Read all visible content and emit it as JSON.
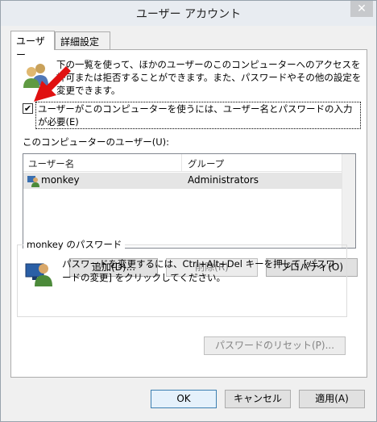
{
  "window": {
    "title": "ユーザー アカウント",
    "close_glyph": "✕"
  },
  "tabs": [
    {
      "label": "ユーザー",
      "active": true
    },
    {
      "label": "詳細設定",
      "active": false
    }
  ],
  "intro_text": "下の一覧を使って、ほかのユーザーのこのコンピューターへのアクセスを許可または拒否することができます。また、パスワードやその他の設定を変更できます。",
  "require_password": {
    "checked": true,
    "check_glyph": "✔",
    "label": "ユーザーがこのコンピューターを使うには、ユーザー名とパスワードの入力が必要(E)"
  },
  "users_section": {
    "label": "このコンピューターのユーザー(U):",
    "columns": [
      "ユーザー名",
      "グループ"
    ],
    "rows": [
      {
        "user": "monkey",
        "group": "Administrators"
      }
    ]
  },
  "user_buttons": {
    "add": "追加(D)...",
    "remove": "削除(R)",
    "properties": "プロパティ(O)"
  },
  "password_group": {
    "legend": "monkey のパスワード",
    "text": "パスワードを変更するには、Ctrl+Alt+Del キーを押して [パスワードの変更] をクリックしてください。",
    "reset_button": "パスワードのリセット(P)..."
  },
  "dialog_buttons": {
    "ok": "OK",
    "cancel": "キャンセル",
    "apply": "適用(A)"
  },
  "colors": {
    "arrow": "#e01010",
    "selection": "#e5e5e5",
    "focus_border": "#3c7fb1"
  },
  "icons": {
    "users": "users-icon",
    "user_row": "user-icon",
    "password": "user-monitor-icon",
    "arrow": "red-arrow-icon"
  }
}
